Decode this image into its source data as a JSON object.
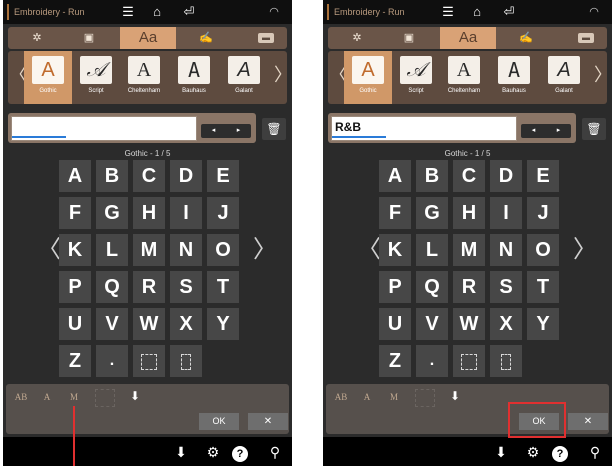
{
  "screens": [
    {
      "app_title": "Embroidery - Run",
      "input_text": "",
      "page_label": "Gothic - 1 / 5"
    },
    {
      "app_title": "Embroidery - Run",
      "input_text": "R&B",
      "page_label": "Gothic - 1 / 5"
    }
  ],
  "category_tabs": [
    "✲",
    "▣",
    "Aa",
    "✍",
    "▬"
  ],
  "active_category": "Aa",
  "fonts": [
    {
      "glyph": "A",
      "name": "Gothic",
      "active": true
    },
    {
      "glyph": "𝒜",
      "name": "Script",
      "active": false
    },
    {
      "glyph": "A",
      "name": "Cheltenham",
      "active": false
    },
    {
      "glyph": "A",
      "name": "Bauhaus",
      "active": false
    },
    {
      "glyph": "A",
      "name": "Galant",
      "active": false
    }
  ],
  "cursor_left": "◂",
  "cursor_right": "▸",
  "keys": [
    "A",
    "B",
    "C",
    "D",
    "E",
    "F",
    "G",
    "H",
    "I",
    "J",
    "K",
    "L",
    "M",
    "N",
    "O",
    "P",
    "Q",
    "R",
    "S",
    "T",
    "U",
    "V",
    "W",
    "X",
    "Y",
    "Z",
    "."
  ],
  "bottom_icons": [
    "AB",
    "A",
    "M"
  ],
  "ok_label": "OK",
  "close_label": "✕",
  "icons": {
    "topbar": [
      "menu-icon",
      "home-icon",
      "back-icon",
      "wifi-icon"
    ],
    "footer": [
      "import-icon",
      "gear-icon",
      "help-icon",
      "wrench-icon"
    ]
  },
  "colors": {
    "accent": "#d09868",
    "highlight": "#e03030",
    "background": "#2b2b2b"
  }
}
